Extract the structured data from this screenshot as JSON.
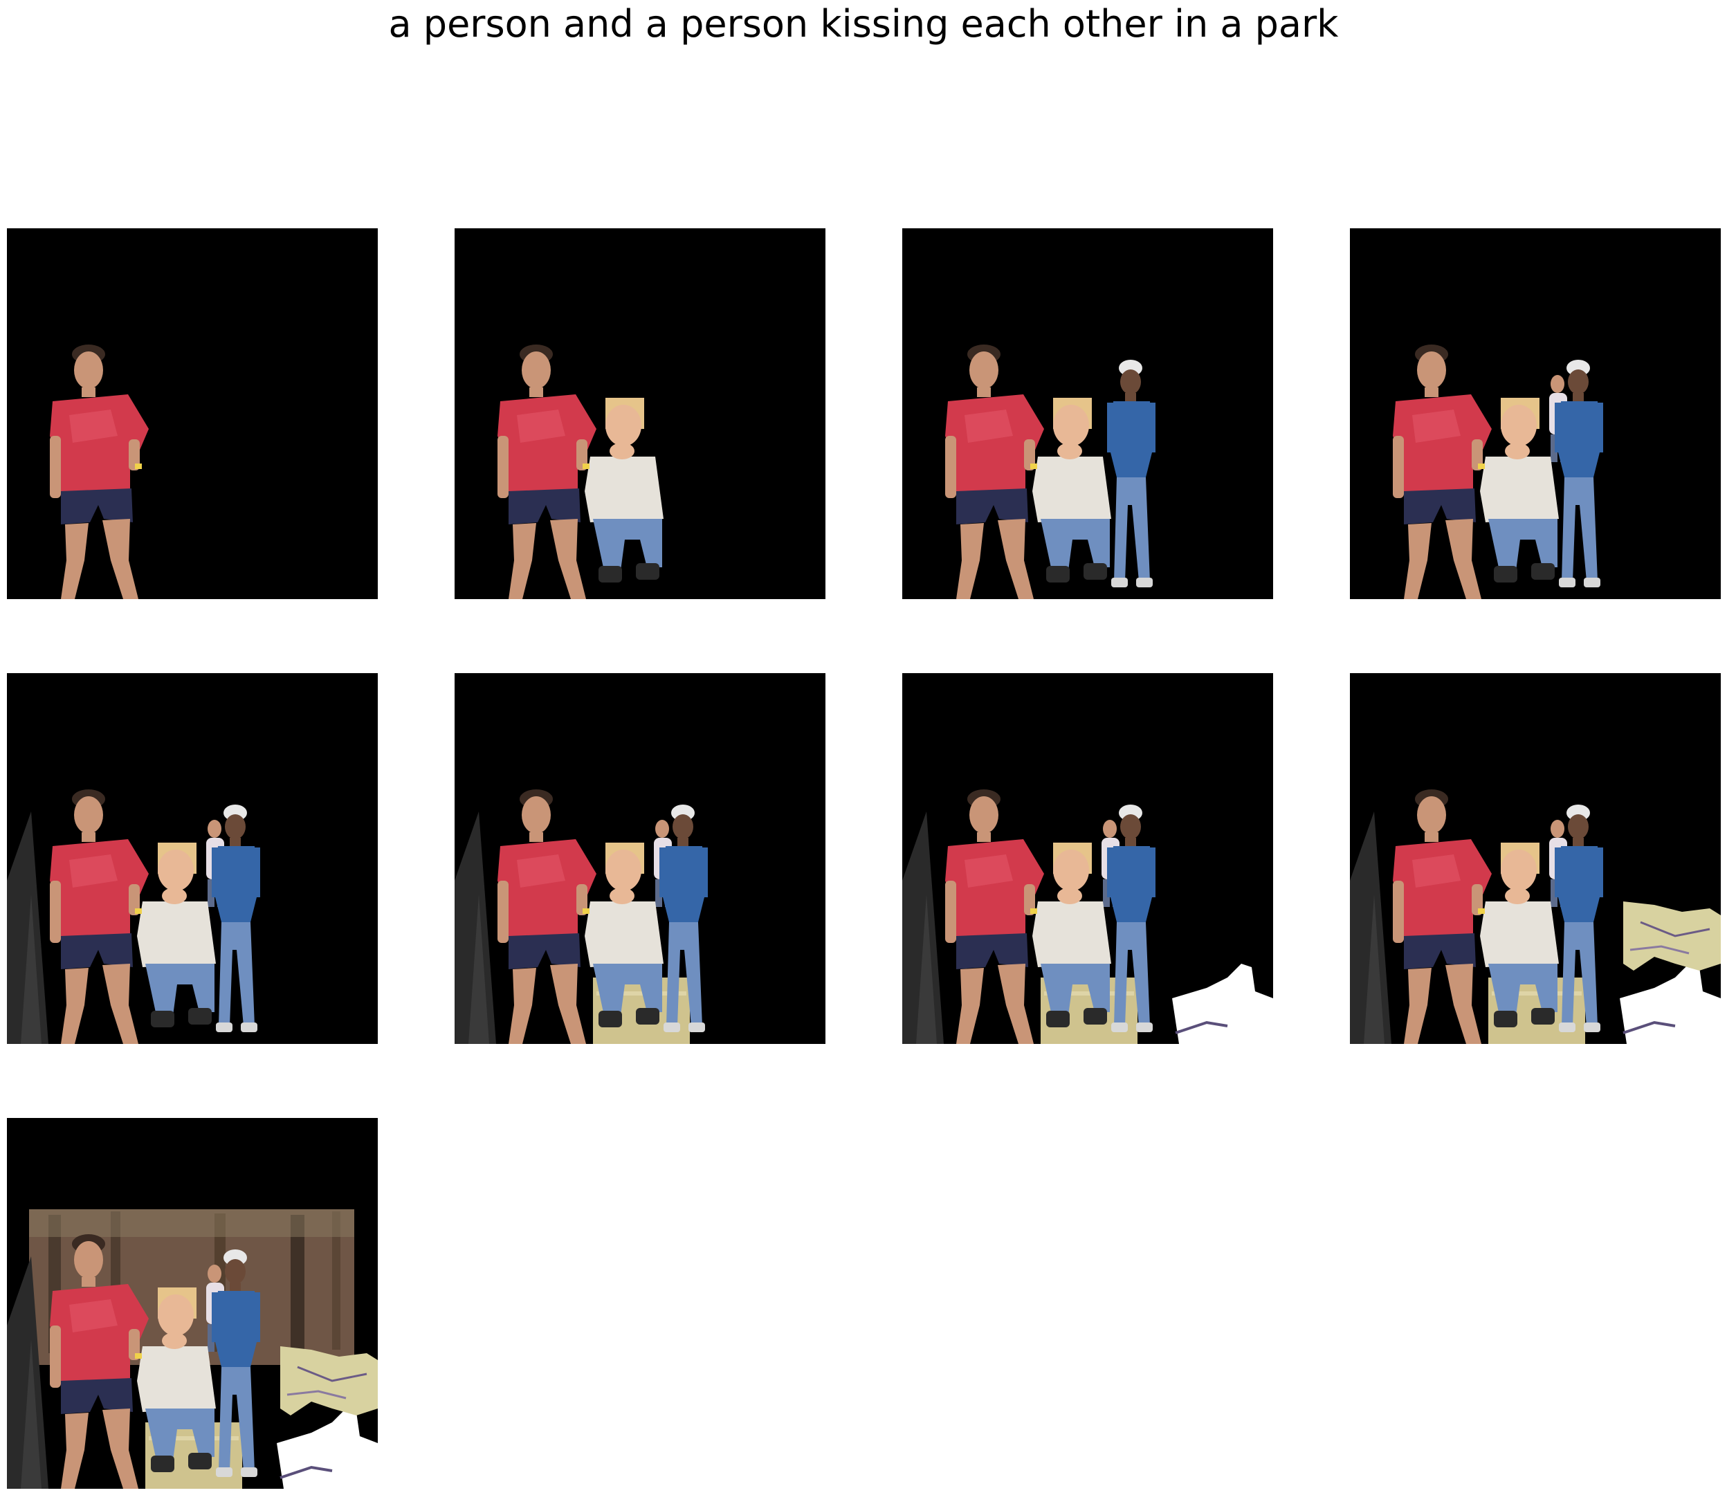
{
  "title": "a person and a person kissing each other in a park",
  "panels": [
    {
      "index": 1,
      "layers": [
        "man-red-shirt"
      ]
    },
    {
      "index": 2,
      "layers": [
        "man-red-shirt",
        "child-white-sweater"
      ]
    },
    {
      "index": 3,
      "layers": [
        "man-red-shirt",
        "child-white-sweater",
        "man-blue-shirt"
      ]
    },
    {
      "index": 4,
      "layers": [
        "man-red-shirt",
        "child-white-sweater",
        "man-blue-shirt",
        "background-person"
      ]
    },
    {
      "index": 5,
      "layers": [
        "man-red-shirt",
        "child-white-sweater",
        "man-blue-shirt",
        "background-person",
        "dark-ground-left"
      ]
    },
    {
      "index": 6,
      "layers": [
        "man-red-shirt",
        "child-white-sweater",
        "man-blue-shirt",
        "background-person",
        "dark-ground-left",
        "grass-patch"
      ]
    },
    {
      "index": 7,
      "layers": [
        "man-red-shirt",
        "child-white-sweater",
        "man-blue-shirt",
        "background-person",
        "dark-ground-left",
        "grass-patch",
        "white-patch-right"
      ]
    },
    {
      "index": 8,
      "layers": [
        "man-red-shirt",
        "child-white-sweater",
        "man-blue-shirt",
        "background-person",
        "dark-ground-left",
        "grass-patch",
        "white-patch-right",
        "yellow-ground-right"
      ]
    },
    {
      "index": 9,
      "layers": [
        "man-red-shirt",
        "child-white-sweater",
        "man-blue-shirt",
        "background-person",
        "dark-ground-left",
        "grass-patch",
        "white-patch-right",
        "yellow-ground-right",
        "forest-background"
      ]
    }
  ],
  "colors": {
    "background": "#000000",
    "red_shirt": "#d23a4c",
    "shorts": "#2b2f52",
    "skin": "#c99577",
    "sweater": "#e6e2da",
    "jeans": "#6f8fc0",
    "blue_shirt": "#3566a8",
    "grass": "#c9c08a",
    "forest": "#6a5242"
  }
}
